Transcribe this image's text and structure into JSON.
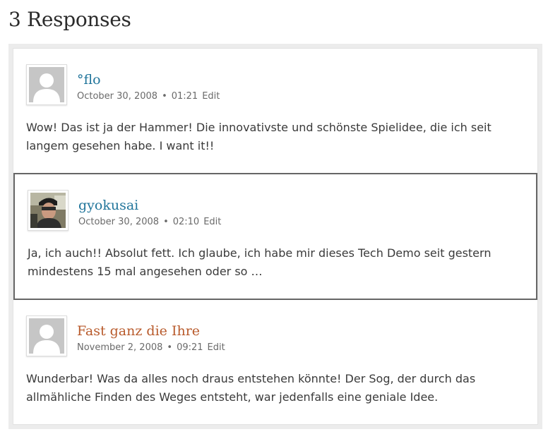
{
  "heading": "3 Responses",
  "comments": [
    {
      "author": "°flo",
      "date": "October 30, 2008",
      "separator": "•",
      "time": "01:21",
      "edit_label": "Edit",
      "text": "Wow! Das ist ja der Hammer! Die innovativste und schönste Spielidee, die ich seit langem gesehen habe. I want it!!",
      "avatar": "default-avatar-icon",
      "author_color": "#21759b"
    },
    {
      "author": "gyokusai",
      "date": "October 30, 2008",
      "separator": "•",
      "time": "02:10",
      "edit_label": "Edit",
      "text": "Ja, ich auch!! Absolut fett. Ich glaube, ich habe mir dieses Tech Demo seit gestern mindestens 15 mal angesehen oder so …",
      "avatar": "user-photo-avatar",
      "author_color": "#21759b"
    },
    {
      "author": "Fast ganz die Ihre",
      "date": "November 2, 2008",
      "separator": "•",
      "time": "09:21",
      "edit_label": "Edit",
      "text": "Wunderbar! Was da alles noch draus entstehen könnte! Der Sog, der durch das allmähliche Finden des Weges entsteht, war jedenfalls eine geniale Idee.",
      "avatar": "default-avatar-icon",
      "author_color": "#b85a2b"
    }
  ]
}
